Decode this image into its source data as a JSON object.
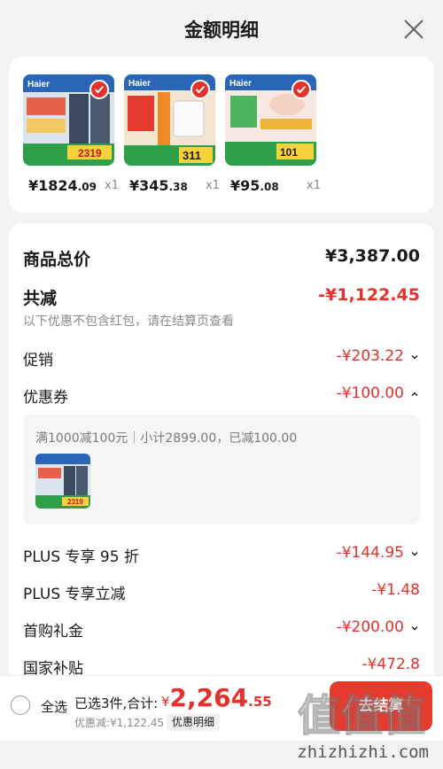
{
  "header": {
    "title": "金额明细"
  },
  "products": [
    {
      "price_int": "¥1824",
      "price_dec": ".09",
      "qty": "x1",
      "brand": "Haier",
      "badge": "2319"
    },
    {
      "price_int": "¥345",
      "price_dec": ".38",
      "qty": "x1",
      "brand": "Haier",
      "badge": "311"
    },
    {
      "price_int": "¥95",
      "price_dec": ".08",
      "qty": "x1",
      "brand": "Haier",
      "badge": "101"
    }
  ],
  "summary": {
    "total_label": "商品总价",
    "total_value": "¥3,387.00",
    "reduce_label": "共减",
    "reduce_value": "-¥1,122.45",
    "note": "以下优惠不包含红包，请在结算页查看",
    "items": [
      {
        "label": "促销",
        "value": "-¥203.22"
      },
      {
        "label": "优惠券",
        "value": "-¥100.00"
      },
      {
        "label": "PLUS 专享 95 折",
        "value": "-¥144.95"
      },
      {
        "label": "PLUS 专享立减",
        "value": "-¥1.48"
      },
      {
        "label": "首购礼金",
        "value": "-¥200.00"
      },
      {
        "label": "国家补贴",
        "value": "-¥472.8"
      }
    ],
    "coupon_desc": "满1000减100元｜小计2899.00，已减100.00"
  },
  "bottom_bar": {
    "select_all": "全选",
    "selected": "已选3件,合计:",
    "currency": "¥",
    "total_int": "2,264",
    "total_dec": ".55",
    "discount": "优惠减:¥1,122.45",
    "detail_btn": "优惠明细",
    "checkout": "去结算"
  },
  "watermark": {
    "site": "zhizhizhi.com",
    "logo_text": "值值值"
  },
  "colors": {
    "accent": "#e4312b",
    "checkout_bg": "#e53a2e",
    "card_bg": "#ffffff",
    "page_bg": "#f2f2f2"
  }
}
